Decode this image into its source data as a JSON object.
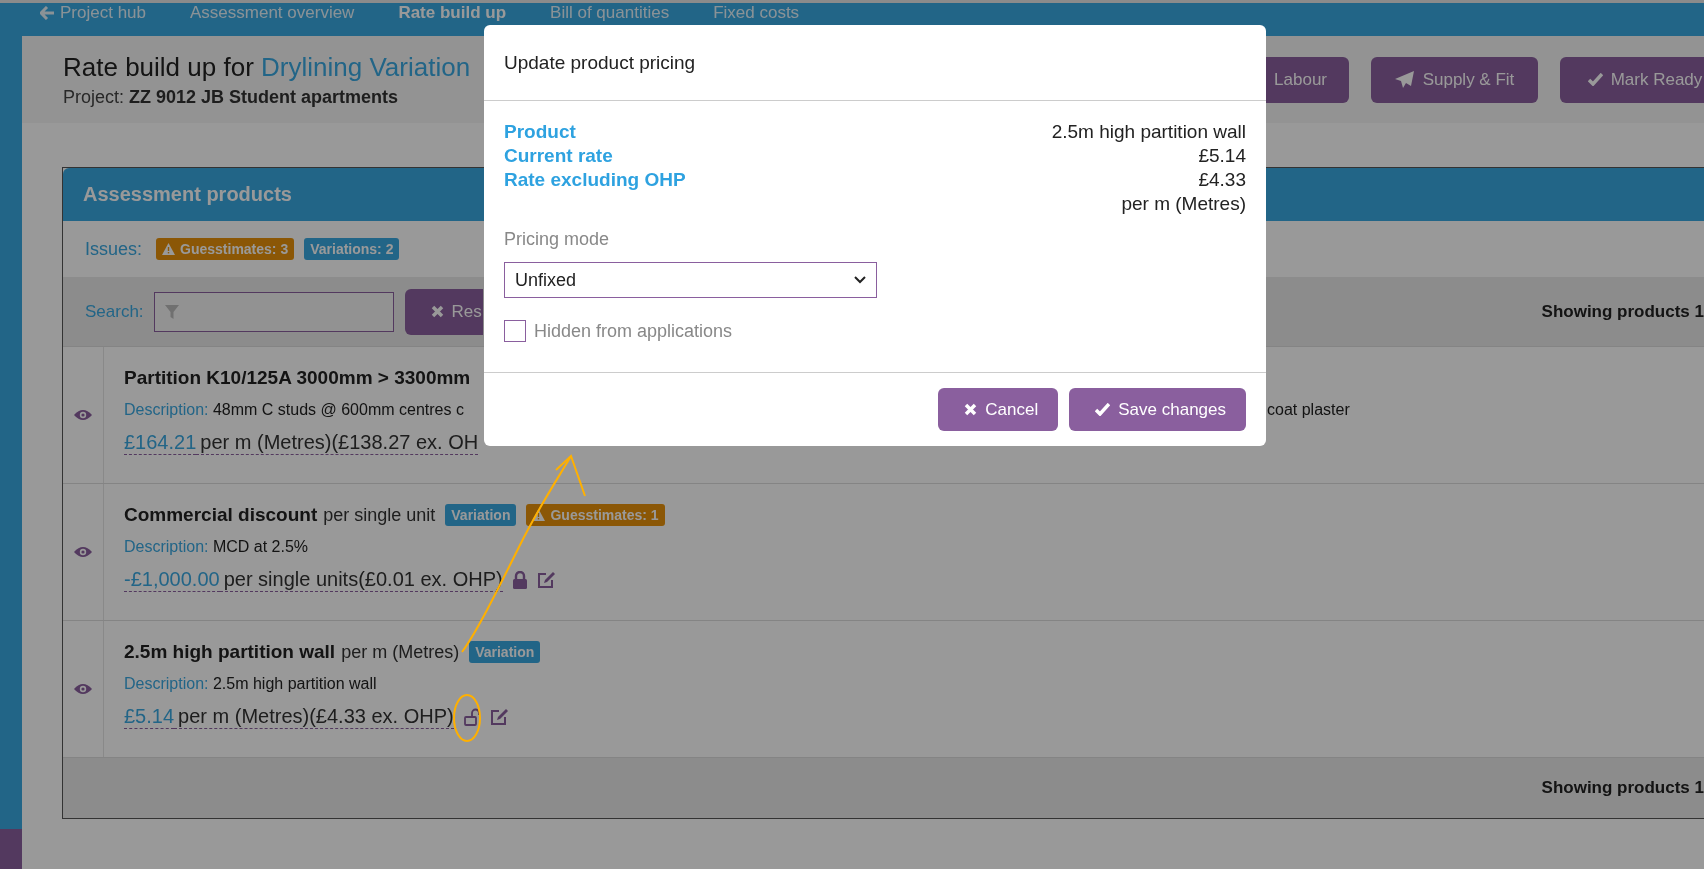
{
  "nav": [
    {
      "label": "Project hub",
      "kind": "back",
      "selected": false
    },
    {
      "label": "Assessment overview",
      "selected": false
    },
    {
      "label": "Rate build up",
      "selected": true
    },
    {
      "label": "Bill of quantities",
      "selected": false
    },
    {
      "label": "Fixed costs",
      "selected": false
    }
  ],
  "header": {
    "title_prefix": "Rate build up for",
    "title_link": "Drylining Variation",
    "project_label": "Project:",
    "project_name": "ZZ 9012 JB Student apartments"
  },
  "header_buttons": [
    {
      "label": "Labour"
    },
    {
      "label": "Supply & Fit",
      "kind": "send"
    },
    {
      "label": "Mark Ready",
      "kind": "confirm"
    }
  ],
  "panel": {
    "title": "Assessment products",
    "issues_label": "Issues:",
    "issue_badges": [
      {
        "label": "Guesstimates: 3",
        "kind": "warning"
      },
      {
        "label": "Variations: 2",
        "kind": "info"
      }
    ],
    "search_label": "Search:",
    "reset_label": "Res",
    "showing": "Showing products 1"
  },
  "products": [
    {
      "name": "Partition K10/125A 3000mm > 3300mm",
      "description_label": "Description:",
      "description": "48mm C studs @ 600mm centres c",
      "description_tail": "coat plaster",
      "price": "£164.21",
      "price_text": "per m (Metres)(£138.27 ex. OH"
    },
    {
      "name": "Commercial discount",
      "unit": "per single unit",
      "badges": [
        {
          "label": "Variation",
          "kind": "info"
        },
        {
          "label": "Guesstimates: 1",
          "kind": "warning"
        }
      ],
      "description_label": "Description:",
      "description": "MCD at 2.5%",
      "price": "-£1,000.00",
      "price_text": "per single units(£0.01 ex. OHP)",
      "locked": true
    },
    {
      "name": "2.5m high partition wall",
      "unit": "per m (Metres)",
      "badges": [
        {
          "label": "Variation",
          "kind": "info"
        }
      ],
      "description_label": "Description:",
      "description": "2.5m high partition wall",
      "price": "£5.14",
      "price_text": "per m (Metres)(£4.33 ex. OHP)",
      "locked": false
    }
  ],
  "footer": {
    "showing": "Showing products 1"
  },
  "modal": {
    "title": "Update product pricing",
    "details": [
      {
        "label": "Product",
        "value": "2.5m high partition wall"
      },
      {
        "label": "Current rate",
        "value": "£5.14"
      },
      {
        "label": "Rate excluding OHP",
        "value": "£4.33"
      },
      {
        "value": "per m (Metres)"
      }
    ],
    "pricing_mode_label": "Pricing mode",
    "pricing_mode_value": "Unfixed",
    "hidden_checkbox": {
      "label": "Hidden from applications",
      "checked": false
    },
    "buttons": [
      {
        "label": "Cancel",
        "kind": "cancel"
      },
      {
        "label": "Save changes",
        "kind": "confirm"
      }
    ]
  }
}
